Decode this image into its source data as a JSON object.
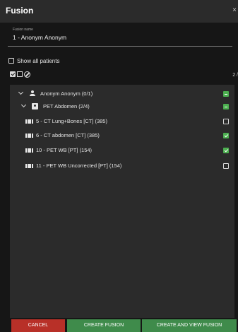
{
  "dialog": {
    "title": "Fusion",
    "close_glyph": "×"
  },
  "fusion_name": {
    "label": "Fusion name",
    "value": "1 - Anonym Anonym"
  },
  "show_all_patients": {
    "label": "Show all patients",
    "checked": false
  },
  "toolbar": {
    "count": "2 /"
  },
  "tree": {
    "patient": {
      "label": "Anonym Anonym (0/1)",
      "state": "indeterminate",
      "icon": "person-icon"
    },
    "study": {
      "label": "PET Abdomen (2/4)",
      "state": "indeterminate",
      "icon": "study-icon"
    },
    "series": [
      {
        "label": "5 - CT Lung+Bones [CT] (385)",
        "checked": false,
        "icon": "series-icon"
      },
      {
        "label": "6 - CT abdomen [CT] (385)",
        "checked": true,
        "icon": "series-icon"
      },
      {
        "label": "10 - PET WB [PT] (154)",
        "checked": true,
        "icon": "series-icon"
      },
      {
        "label": "11 - PET WB Uncorrected [PT] (154)",
        "checked": false,
        "icon": "series-icon"
      }
    ]
  },
  "buttons": {
    "cancel": "CANCEL",
    "create": "CREATE FUSION",
    "create_view": "CREATE AND VIEW FUSION"
  },
  "colors": {
    "accent_green": "#4caf50",
    "cancel_red": "#b83028",
    "button_green": "#3f8b4b"
  }
}
